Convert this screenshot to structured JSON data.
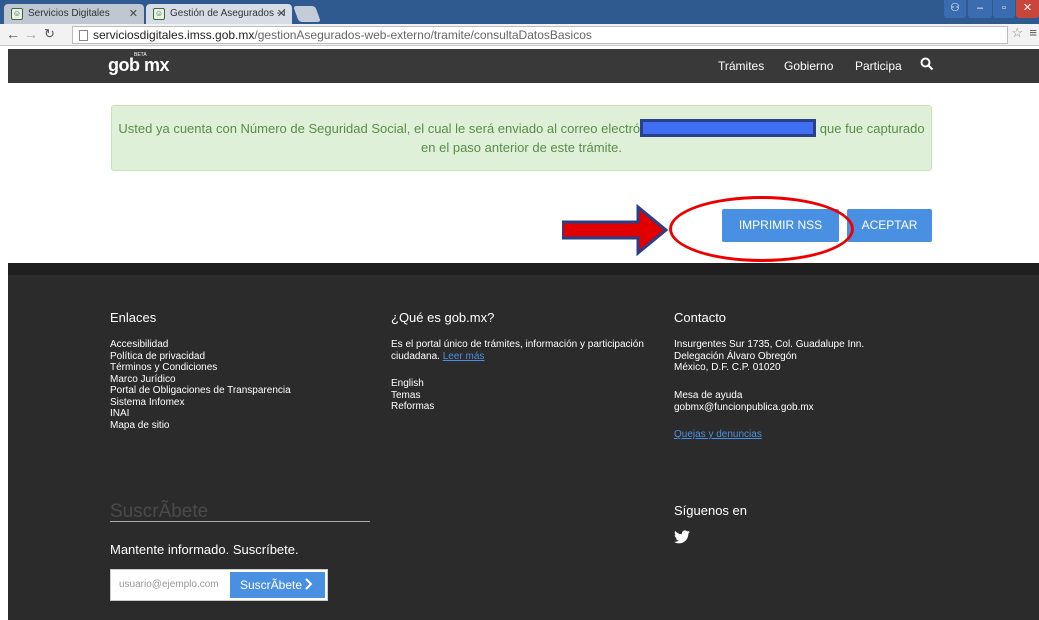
{
  "browser": {
    "tabs": [
      {
        "title": "Servicios Digitales"
      },
      {
        "title": "Gestión de Asegurados - I"
      }
    ],
    "url_host": "serviciosdigitales.imss.gob.mx",
    "url_path": "/gestionAsegurados-web-externo/tramite/consultaDatosBasicos"
  },
  "header": {
    "logo": "gob mx",
    "logo_badge": "BETA",
    "nav": [
      "Trámites",
      "Gobierno",
      "Participa"
    ]
  },
  "alert": {
    "text_before": "Usted ya cuenta con Número de Seguridad Social, el cual le será enviado al correo electró",
    "text_after": "que fue capturado en el paso anterior de este trámite."
  },
  "actions": {
    "print_label": "IMPRIMIR NSS",
    "accept_label": "ACEPTAR"
  },
  "footer": {
    "links_title": "Enlaces",
    "links": [
      "Accesibilidad",
      "Política de privacidad",
      "Términos y Condiciones",
      "Marco Jurídico",
      "Portal de Obligaciones de Transparencia",
      "Sistema Infomex",
      "INAI",
      "Mapa de sitio"
    ],
    "about_title": "¿Qué es gob.mx?",
    "about_text": "Es el portal único de trámites, información y participación ciudadana.",
    "about_more": "Leer más",
    "about_links": [
      "English",
      "Temas",
      "Reformas"
    ],
    "contact_title": "Contacto",
    "contact_address": [
      "Insurgentes Sur 1735, Col. Guadalupe Inn.",
      "Delegación Álvaro Obregón",
      "México, D.F. C.P. 01020"
    ],
    "help_title": "Mesa de ayuda",
    "help_email": "gobmx@funcionpublica.gob.mx",
    "complaints": "Quejas y denuncias",
    "social_title": "Síguenos en",
    "subscribe_title": "SuscrÃbete",
    "subscribe_lead": "Mantente informado. Suscríbete.",
    "subscribe_placeholder": "usuario@ejemplo.com",
    "subscribe_button": "SuscrÃbete"
  },
  "colors": {
    "accent": "#4a90e2",
    "header_bg": "#393939",
    "footer_bg": "#2b2b2b",
    "alert_bg": "#dff0d8",
    "annotation": "#e00000"
  }
}
